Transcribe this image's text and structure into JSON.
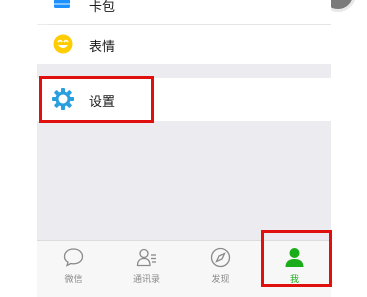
{
  "menu": {
    "card_label": "卡包",
    "sticker_label": "表情",
    "settings_label": "设置"
  },
  "tabbar": {
    "tabs": [
      {
        "label": "微信",
        "icon": "chat-bubble-icon"
      },
      {
        "label": "通讯录",
        "icon": "contacts-icon"
      },
      {
        "label": "发现",
        "icon": "compass-icon"
      },
      {
        "label": "我",
        "icon": "person-icon",
        "active": true
      }
    ]
  },
  "colors": {
    "active_tab": "#1aad19",
    "inactive_tab": "#8a8a8a",
    "highlight_box": "#e0100e",
    "settings_icon": "#2a9fe0",
    "card_icon": "#1e90ff",
    "sticker_icon": "#ffcc00"
  }
}
